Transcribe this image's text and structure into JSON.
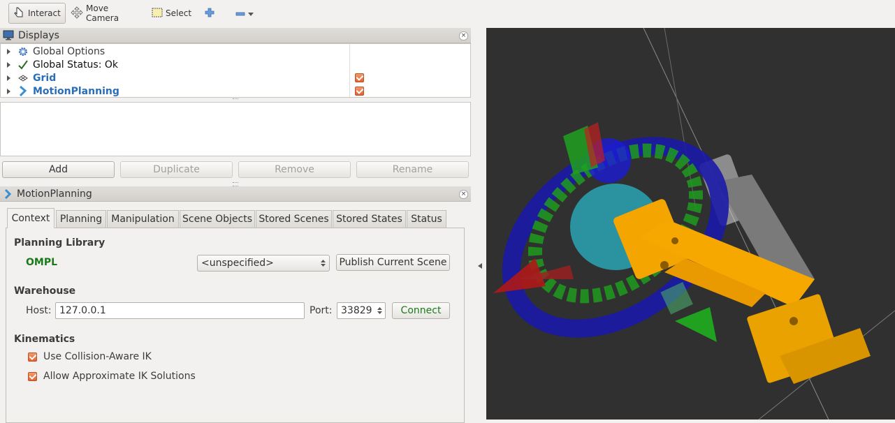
{
  "toolbar": {
    "interact": "Interact",
    "move_camera": "Move Camera",
    "select": "Select"
  },
  "displays_panel": {
    "title": "Displays",
    "items": [
      {
        "label": "Global Options",
        "icon": "gear-icon"
      },
      {
        "label": "Global Status: Ok",
        "icon": "checkmark-icon"
      },
      {
        "label": "Grid",
        "icon": "grid-icon",
        "checked": true
      },
      {
        "label": "MotionPlanning",
        "icon": "motion-planning-icon",
        "checked": true
      }
    ],
    "buttons": {
      "add": "Add",
      "duplicate": "Duplicate",
      "remove": "Remove",
      "rename": "Rename"
    }
  },
  "motion_panel": {
    "title": "MotionPlanning",
    "tabs": [
      "Context",
      "Planning",
      "Manipulation",
      "Scene Objects",
      "Stored Scenes",
      "Stored States",
      "Status"
    ],
    "active_tab": "Context",
    "planning_library": {
      "heading": "Planning Library",
      "library": "OMPL",
      "planner": "<unspecified>",
      "publish_button": "Publish Current Scene"
    },
    "warehouse": {
      "heading": "Warehouse",
      "host_label": "Host:",
      "host_value": "127.0.0.1",
      "port_label": "Port:",
      "port_value": "33829",
      "connect_button": "Connect"
    },
    "kinematics": {
      "heading": "Kinematics",
      "collision_aware_ik": "Use Collision-Aware IK",
      "approx_ik": "Allow Approximate IK Solutions"
    }
  },
  "colors": {
    "viewport_bg": "#303030",
    "link_blue": "#2a6ebb",
    "ompl_green": "#1a7a1a",
    "checkbox_orange": "#e8693a",
    "robot_orange": "#f5a500"
  }
}
